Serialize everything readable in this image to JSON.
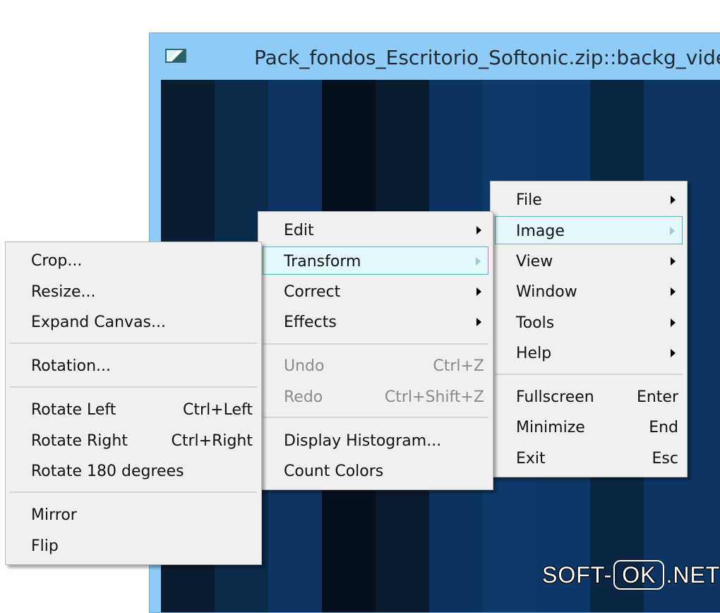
{
  "window": {
    "title": "Pack_fondos_Escritorio_Softonic.zip::backg_video_",
    "icon": "image-file-icon"
  },
  "viewer": {
    "stripe_colors": [
      "#0b1c30",
      "#0a2a4c",
      "#0d3563",
      "#061120",
      "#0a1b2e",
      "#0c3461",
      "#0f3a6b",
      "#0e3868",
      "#0a2644",
      "#0c3564",
      "#0d3564"
    ]
  },
  "main_menu": {
    "items": [
      {
        "label": "File",
        "submenu": true
      },
      {
        "label": "Image",
        "submenu": true,
        "highlighted": true
      },
      {
        "label": "View",
        "submenu": true
      },
      {
        "label": "Window",
        "submenu": true
      },
      {
        "label": "Tools",
        "submenu": true
      },
      {
        "label": "Help",
        "submenu": true
      },
      {
        "label": "Fullscreen",
        "shortcut": "Enter"
      },
      {
        "label": "Minimize",
        "shortcut": "End"
      },
      {
        "label": "Exit",
        "shortcut": "Esc"
      }
    ]
  },
  "image_menu": {
    "items": [
      {
        "label": "Edit",
        "submenu": true
      },
      {
        "label": "Transform",
        "submenu": true,
        "highlighted": true
      },
      {
        "label": "Correct",
        "submenu": true
      },
      {
        "label": "Effects",
        "submenu": true
      },
      {
        "label": "Undo",
        "shortcut": "Ctrl+Z",
        "disabled": true
      },
      {
        "label": "Redo",
        "shortcut": "Ctrl+Shift+Z",
        "disabled": true
      },
      {
        "label": "Display Histogram..."
      },
      {
        "label": "Count Colors"
      }
    ]
  },
  "transform_menu": {
    "items": [
      {
        "label": "Crop..."
      },
      {
        "label": "Resize..."
      },
      {
        "label": "Expand Canvas..."
      },
      {
        "label": "Rotation..."
      },
      {
        "label": "Rotate Left",
        "shortcut": "Ctrl+Left"
      },
      {
        "label": "Rotate Right",
        "shortcut": "Ctrl+Right"
      },
      {
        "label": "Rotate 180 degrees"
      },
      {
        "label": "Mirror"
      },
      {
        "label": "Flip"
      }
    ]
  },
  "watermark": {
    "left": "SOFT-",
    "middle": "OK",
    "right": ".NET"
  }
}
